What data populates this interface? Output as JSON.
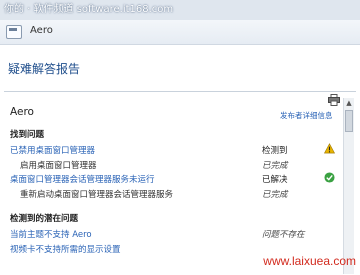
{
  "watermark_top": "你的 · 软件频道 software.it168.com",
  "window": {
    "title": "Aero"
  },
  "page": {
    "heading": "疑难解答报告"
  },
  "report": {
    "label": "Aero",
    "publisher_link": "发布者详细信息",
    "sections": [
      {
        "title": "找到问题",
        "rows": [
          {
            "name": "已禁用桌面窗口管理器",
            "status": "检测到",
            "icon": "warning-icon",
            "link": true,
            "sub": false,
            "italic": false
          },
          {
            "name": "启用桌面窗口管理器",
            "status": "已完成",
            "icon": "",
            "link": false,
            "sub": true,
            "italic": true
          },
          {
            "name": "桌面窗口管理器会话管理器服务未运行",
            "status": "已解决",
            "icon": "check-icon",
            "link": true,
            "sub": false,
            "italic": false
          },
          {
            "name": "重新启动桌面窗口管理器会话管理器服务",
            "status": "已完成",
            "icon": "",
            "link": false,
            "sub": true,
            "italic": true
          }
        ]
      },
      {
        "title": "检测到的潜在问题",
        "rows": [
          {
            "name": "当前主题不支持 Aero",
            "status": "问题不存在",
            "icon": "",
            "link": true,
            "sub": false,
            "italic": true
          },
          {
            "name": "视频卡不支持所需的显示设置",
            "status": "",
            "icon": "",
            "link": true,
            "sub": false,
            "italic": false
          }
        ]
      }
    ]
  },
  "watermark_bottom": "www.laixuea.com",
  "colors": {
    "link": "#2a63b6",
    "heading": "#1f4e8c",
    "warning": "#e8b400",
    "check": "#3aa142"
  }
}
